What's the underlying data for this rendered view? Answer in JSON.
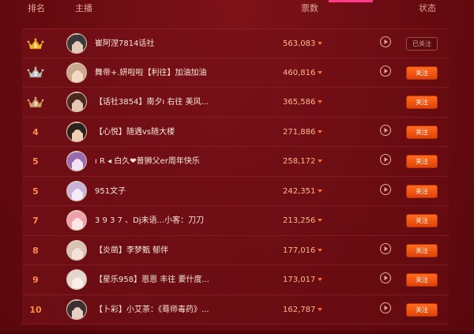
{
  "header": {
    "rank": "排名",
    "host": "主播",
    "votes": "票数",
    "status": "状态"
  },
  "colors": {
    "background": "#6a0c12",
    "votes": "#ffb98a",
    "rank": "#ff8a4c",
    "follow_button": "#ff6b1e",
    "gold": "#f4b52b",
    "silver": "#b9bec8",
    "bronze": "#d49a6a"
  },
  "rows": [
    {
      "rank": "1",
      "crown": "gold",
      "name": "崔阿涅7814话社",
      "votes": "563,083",
      "has_play": true,
      "status": "已关注",
      "followed": true,
      "avatar_color": "#3a3a3a",
      "avatar_skin": "#e6c9b7"
    },
    {
      "rank": "2",
      "crown": "silver",
      "name": "舞帝+.妍啦啦【利往】加油加油",
      "votes": "460,816",
      "has_play": true,
      "status": "关注",
      "followed": false,
      "avatar_color": "#c9a88c",
      "avatar_skin": "#f2d9c4"
    },
    {
      "rank": "3",
      "crown": "bronze",
      "name": "【话社3854】南夕ı 右往 美风...",
      "votes": "365,586",
      "has_play": false,
      "status": "关注",
      "followed": false,
      "avatar_color": "#4a2a20",
      "avatar_skin": "#e8c8b4"
    },
    {
      "rank": "4",
      "crown": "",
      "name": "【心悦】随遇vs随大楼",
      "votes": "271,886",
      "has_play": true,
      "status": "关注",
      "followed": false,
      "avatar_color": "#2b2220",
      "avatar_skin": "#f0d0b0"
    },
    {
      "rank": "5",
      "crown": "",
      "name": "ı R ◂ 白久❤普狮父er周年快乐",
      "votes": "258,172",
      "has_play": true,
      "status": "关注",
      "followed": false,
      "avatar_color": "#9a6ab0",
      "avatar_skin": "#f4e2ee"
    },
    {
      "rank": "5",
      "crown": "",
      "name": "951文子",
      "votes": "242,351",
      "has_play": true,
      "status": "关注",
      "followed": false,
      "avatar_color": "#c9b2d8",
      "avatar_skin": "#f3ecf6"
    },
    {
      "rank": "7",
      "crown": "",
      "name": "3 9 3 7 、Dj未语...小客：刀刀",
      "votes": "213,256",
      "has_play": false,
      "status": "关注",
      "followed": false,
      "avatar_color": "#f0a0a8",
      "avatar_skin": "#ffe6e6"
    },
    {
      "rank": "8",
      "crown": "",
      "name": "【炎凿】李梦甄 郁伴",
      "votes": "177,016",
      "has_play": true,
      "status": "关注",
      "followed": false,
      "avatar_color": "#d8c2b2",
      "avatar_skin": "#f4e2d8"
    },
    {
      "rank": "9",
      "crown": "",
      "name": "【星乐958】恩恩 丰往 要什度...",
      "votes": "173,017",
      "has_play": true,
      "status": "关注",
      "followed": false,
      "avatar_color": "#e4d6cc",
      "avatar_skin": "#f8efe8"
    },
    {
      "rank": "10",
      "crown": "",
      "name": "【卜彩】小艾茶：《蓦师毒药》...",
      "votes": "162,787",
      "has_play": true,
      "status": "关注",
      "followed": false,
      "avatar_color": "#3c3030",
      "avatar_skin": "#e8d0c4"
    }
  ]
}
